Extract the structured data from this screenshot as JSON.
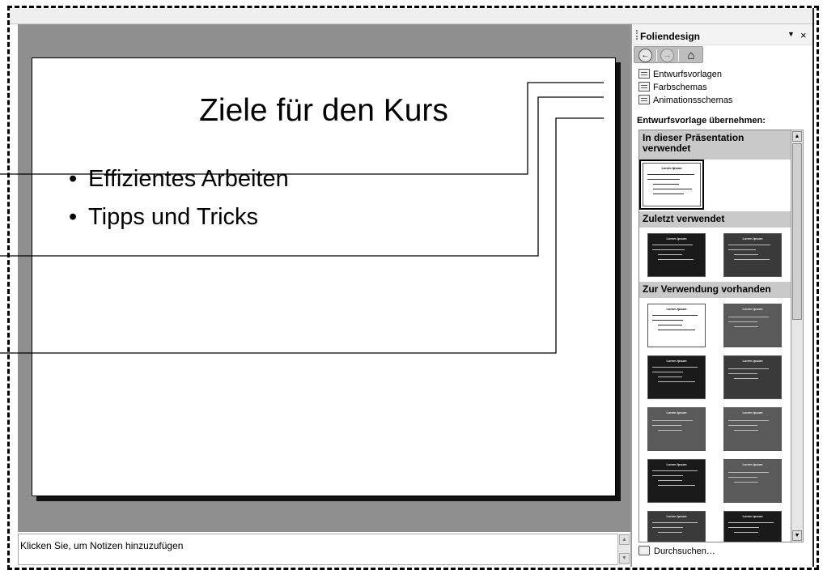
{
  "slide": {
    "title": "Ziele für den Kurs",
    "bullets": [
      {
        "marker": "•",
        "text": "Effizientes Arbeiten"
      },
      {
        "marker": "•",
        "text": "Tipps und Tricks"
      }
    ]
  },
  "notes": {
    "placeholder": "Klicken Sie, um Notizen hinzuzufügen",
    "scroll_up": "▲",
    "scroll_down": "▼"
  },
  "task_pane": {
    "title": "Foliendesign",
    "menu_glyph": "▼",
    "close_glyph": "×",
    "nav": {
      "back": "←",
      "forward": "→",
      "home": "⌂"
    },
    "links": [
      "Entwurfsvorlagen",
      "Farbschemas",
      "Animationsschemas"
    ],
    "apply_label": "Entwurfsvorlage übernehmen:",
    "sections": [
      "In dieser Präsentation verwendet",
      "Zuletzt verwendet",
      "Zur Verwendung vorhanden"
    ],
    "thumbnail_title": "Lorem Ipsum",
    "browse": "Durchsuchen…",
    "scroll_up": "▲",
    "scroll_down": "▼"
  },
  "icons": {
    "links": [
      "design-templates-icon",
      "color-schemes-icon",
      "animation-schemes-icon"
    ],
    "browse": "browse-icon",
    "back": "back-arrow-icon",
    "forward": "forward-arrow-icon",
    "home": "home-icon"
  },
  "colors": {
    "workspace": "#8f8f8f",
    "section_header": "#c9c9c9",
    "nav_bar": "#bdbdbd"
  }
}
